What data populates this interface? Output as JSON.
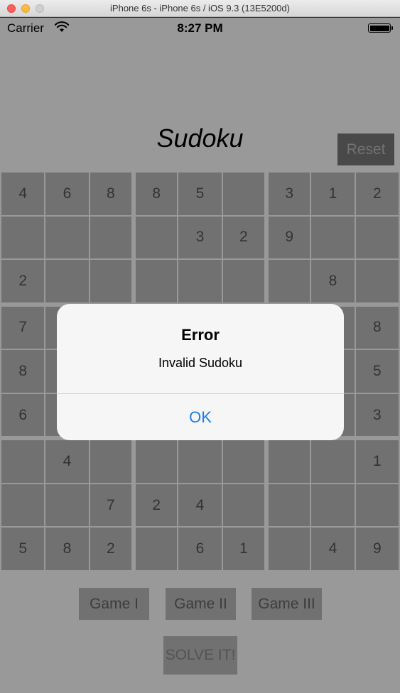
{
  "window": {
    "title": "iPhone 6s - iPhone 6s / iOS 9.3 (13E5200d)"
  },
  "status_bar": {
    "carrier": "Carrier",
    "time": "8:27 PM"
  },
  "app": {
    "title": "Sudoku",
    "reset_label": "Reset",
    "grid": [
      [
        "4",
        "6",
        "8",
        "8",
        "5",
        "",
        "3",
        "1",
        "2"
      ],
      [
        "",
        "",
        "",
        "",
        "3",
        "2",
        "9",
        "",
        ""
      ],
      [
        "2",
        "",
        "",
        "",
        "",
        "",
        "",
        "8",
        ""
      ],
      [
        "7",
        "",
        "",
        "",
        "",
        "",
        "",
        "",
        "8"
      ],
      [
        "8",
        "",
        "",
        "",
        "",
        "",
        "",
        "",
        "5"
      ],
      [
        "6",
        "",
        "",
        "",
        "",
        "",
        "",
        "",
        "3"
      ],
      [
        "",
        "4",
        "",
        "",
        "",
        "",
        "",
        "",
        "1"
      ],
      [
        "",
        "",
        "7",
        "2",
        "4",
        "",
        "",
        "",
        ""
      ],
      [
        "5",
        "8",
        "2",
        "",
        "6",
        "1",
        "",
        "4",
        "9"
      ]
    ],
    "game_buttons": [
      "Game I",
      "Game II",
      "Game III"
    ],
    "solve_label": "SOLVE IT!"
  },
  "alert": {
    "title": "Error",
    "message": "Invalid Sudoku",
    "ok_label": "OK",
    "ok_color": "#1d7cf2"
  }
}
